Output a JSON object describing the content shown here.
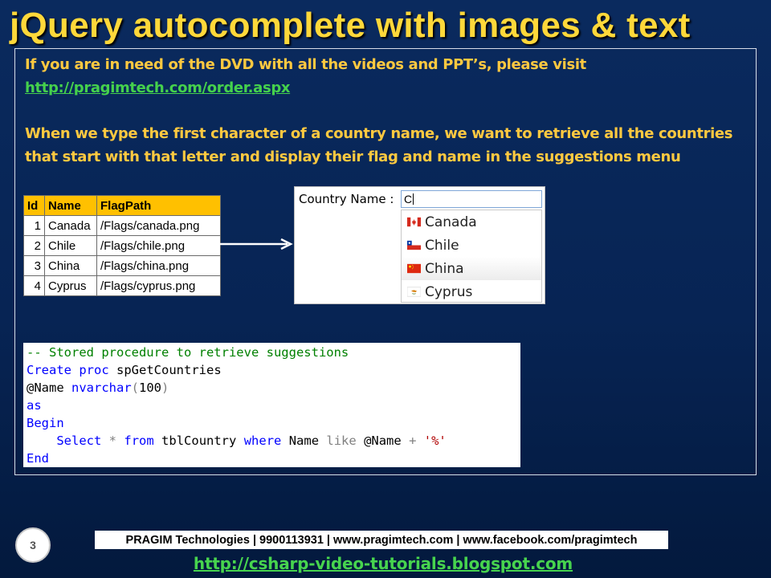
{
  "slide": {
    "title": "jQuery autocomplete with images & text",
    "paragraph1": "If you are in need of the DVD with all the videos and PPT’s, please visit",
    "link": "http://pragimtech.com/order.aspx",
    "paragraph2": "When we type the first character of a country name, we want to retrieve all the countries that start with that letter and display their flag and name in the suggestions menu",
    "slide_number": "3",
    "footer": "PRAGIM Technologies | 9900113931 | www.pragimtech.com | www.facebook.com/pragimtech",
    "footer_link": "http://csharp-video-tutorials.blogspot.com"
  },
  "table": {
    "headers": [
      "Id",
      "Name",
      "FlagPath"
    ],
    "rows": [
      [
        "1",
        "Canada",
        "/Flags/canada.png"
      ],
      [
        "2",
        "Chile",
        "/Flags/chile.png"
      ],
      [
        "3",
        "China",
        "/Flags/china.png"
      ],
      [
        "4",
        "Cyprus",
        "/Flags/cyprus.png"
      ]
    ]
  },
  "autocomplete": {
    "label": "Country Name :",
    "input_value": "C",
    "suggestions": [
      {
        "name": "Canada",
        "flag_icon": "canada-flag-icon"
      },
      {
        "name": "Chile",
        "flag_icon": "chile-flag-icon"
      },
      {
        "name": "China",
        "flag_icon": "china-flag-icon"
      },
      {
        "name": "Cyprus",
        "flag_icon": "cyprus-flag-icon"
      }
    ]
  },
  "code": {
    "comment": "-- Stored procedure to retrieve suggestions",
    "create": "Create",
    "proc": "proc",
    "proc_name": "spGetCountries",
    "param": "@Name",
    "type": "nvarchar",
    "type_open": "(",
    "type_size": "100",
    "type_close": ")",
    "as": "as",
    "begin": "Begin",
    "select": "Select",
    "star": "*",
    "from": "from",
    "table": "tblCountry",
    "where": "where",
    "column": "Name",
    "like": "like",
    "param2": "@Name",
    "plus": "+",
    "literal": "'%'",
    "end": "End"
  },
  "colors": {
    "title": "#ffd83a",
    "body_text": "#ffc940",
    "link": "#45d14c",
    "table_header": "#ffc000",
    "sql_keyword": "#0000ff",
    "sql_comment": "#008000"
  }
}
